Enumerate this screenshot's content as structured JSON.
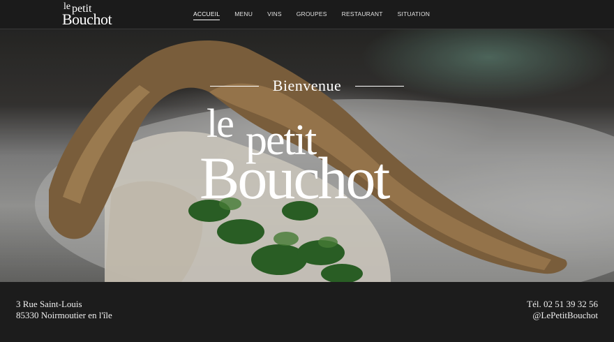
{
  "header": {
    "logo": {
      "le": "le",
      "petit": "petit",
      "bouchot": "Bouchot"
    },
    "nav": [
      {
        "label": "ACCUEIL",
        "active": true
      },
      {
        "label": "MENU"
      },
      {
        "label": "VINS"
      },
      {
        "label": "GROUPES"
      },
      {
        "label": "RESTAURANT"
      },
      {
        "label": "SITUATION"
      }
    ]
  },
  "hero": {
    "welcome": "Bienvenue",
    "logo": {
      "le": "le",
      "petit": "petit",
      "bouchot": "Bouchot"
    }
  },
  "footer": {
    "address_line1": "3 Rue Saint-Louis",
    "address_line2": "85330 Noirmoutier en l'île",
    "phone": "Tél. 02 51 39 32 56",
    "handle": "@LePetitBouchot"
  },
  "colors": {
    "bar_background": "#1b1b1b",
    "text": "#ffffff"
  }
}
